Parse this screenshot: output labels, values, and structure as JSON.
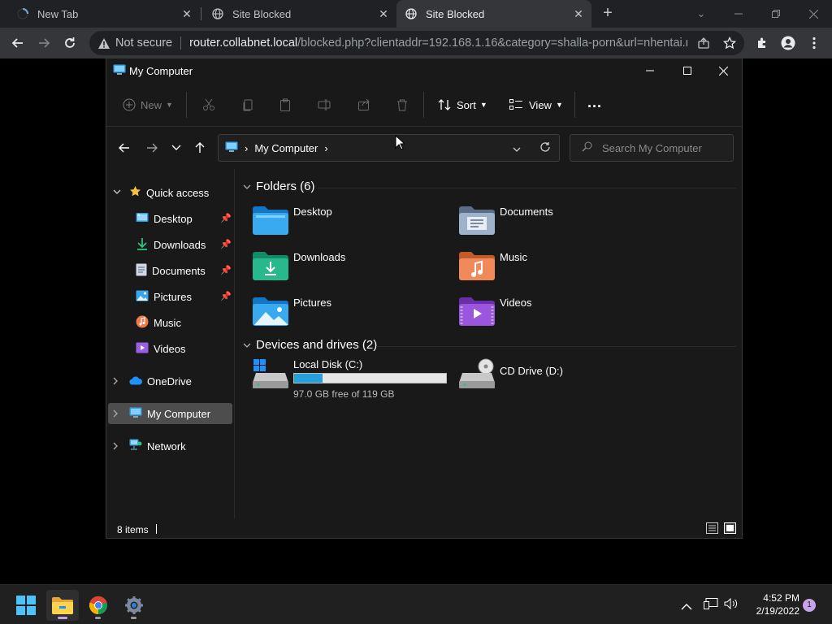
{
  "browser": {
    "tabs": [
      {
        "title": "New Tab",
        "loading": true
      },
      {
        "title": "Site Blocked"
      },
      {
        "title": "Site Blocked",
        "active": true
      }
    ],
    "security_label": "Not secure",
    "url_host": "router.collabnet.local",
    "url_path": "/blocked.php?clientaddr=192.168.1.16&category=shalla-porn&url=nhentai.n..."
  },
  "explorer": {
    "title": "My Computer",
    "toolbar": {
      "new_label": "New",
      "sort_label": "Sort",
      "view_label": "View",
      "more_label": "..."
    },
    "breadcrumb": {
      "location": "My Computer"
    },
    "search_placeholder": "Search My Computer",
    "nav": {
      "quick_access": "Quick access",
      "pinned": [
        {
          "label": "Desktop",
          "icon": "desktop-icon",
          "pinned": true
        },
        {
          "label": "Downloads",
          "icon": "downloads-icon",
          "pinned": true
        },
        {
          "label": "Documents",
          "icon": "documents-icon",
          "pinned": true
        },
        {
          "label": "Pictures",
          "icon": "pictures-icon",
          "pinned": true
        },
        {
          "label": "Music",
          "icon": "music-icon",
          "pinned": false
        },
        {
          "label": "Videos",
          "icon": "videos-icon",
          "pinned": false
        }
      ],
      "onedrive": "OneDrive",
      "my_computer": "My Computer",
      "network": "Network"
    },
    "folders_header": "Folders (6)",
    "folders": [
      {
        "name": "Desktop",
        "icon": "desktop-folder-icon"
      },
      {
        "name": "Documents",
        "icon": "documents-folder-icon"
      },
      {
        "name": "Downloads",
        "icon": "downloads-folder-icon"
      },
      {
        "name": "Music",
        "icon": "music-folder-icon"
      },
      {
        "name": "Pictures",
        "icon": "pictures-folder-icon"
      },
      {
        "name": "Videos",
        "icon": "videos-folder-icon"
      }
    ],
    "drives_header": "Devices and drives (2)",
    "drives": [
      {
        "name": "Local Disk (C:)",
        "free_text": "97.0 GB free of 119 GB",
        "used_fraction": 0.185
      },
      {
        "name": "CD Drive (D:)"
      }
    ],
    "status": "8 items"
  },
  "taskbar": {
    "time": "4:52 PM",
    "date": "2/19/2022",
    "notification_count": "1"
  },
  "colors": {
    "accent": "#0078d4",
    "drive_bar": "#26a0da",
    "folder_blue": "#1e9be0",
    "folder_green": "#1ba785",
    "folder_orange": "#f0783c",
    "folder_purple": "#8a46c8"
  }
}
